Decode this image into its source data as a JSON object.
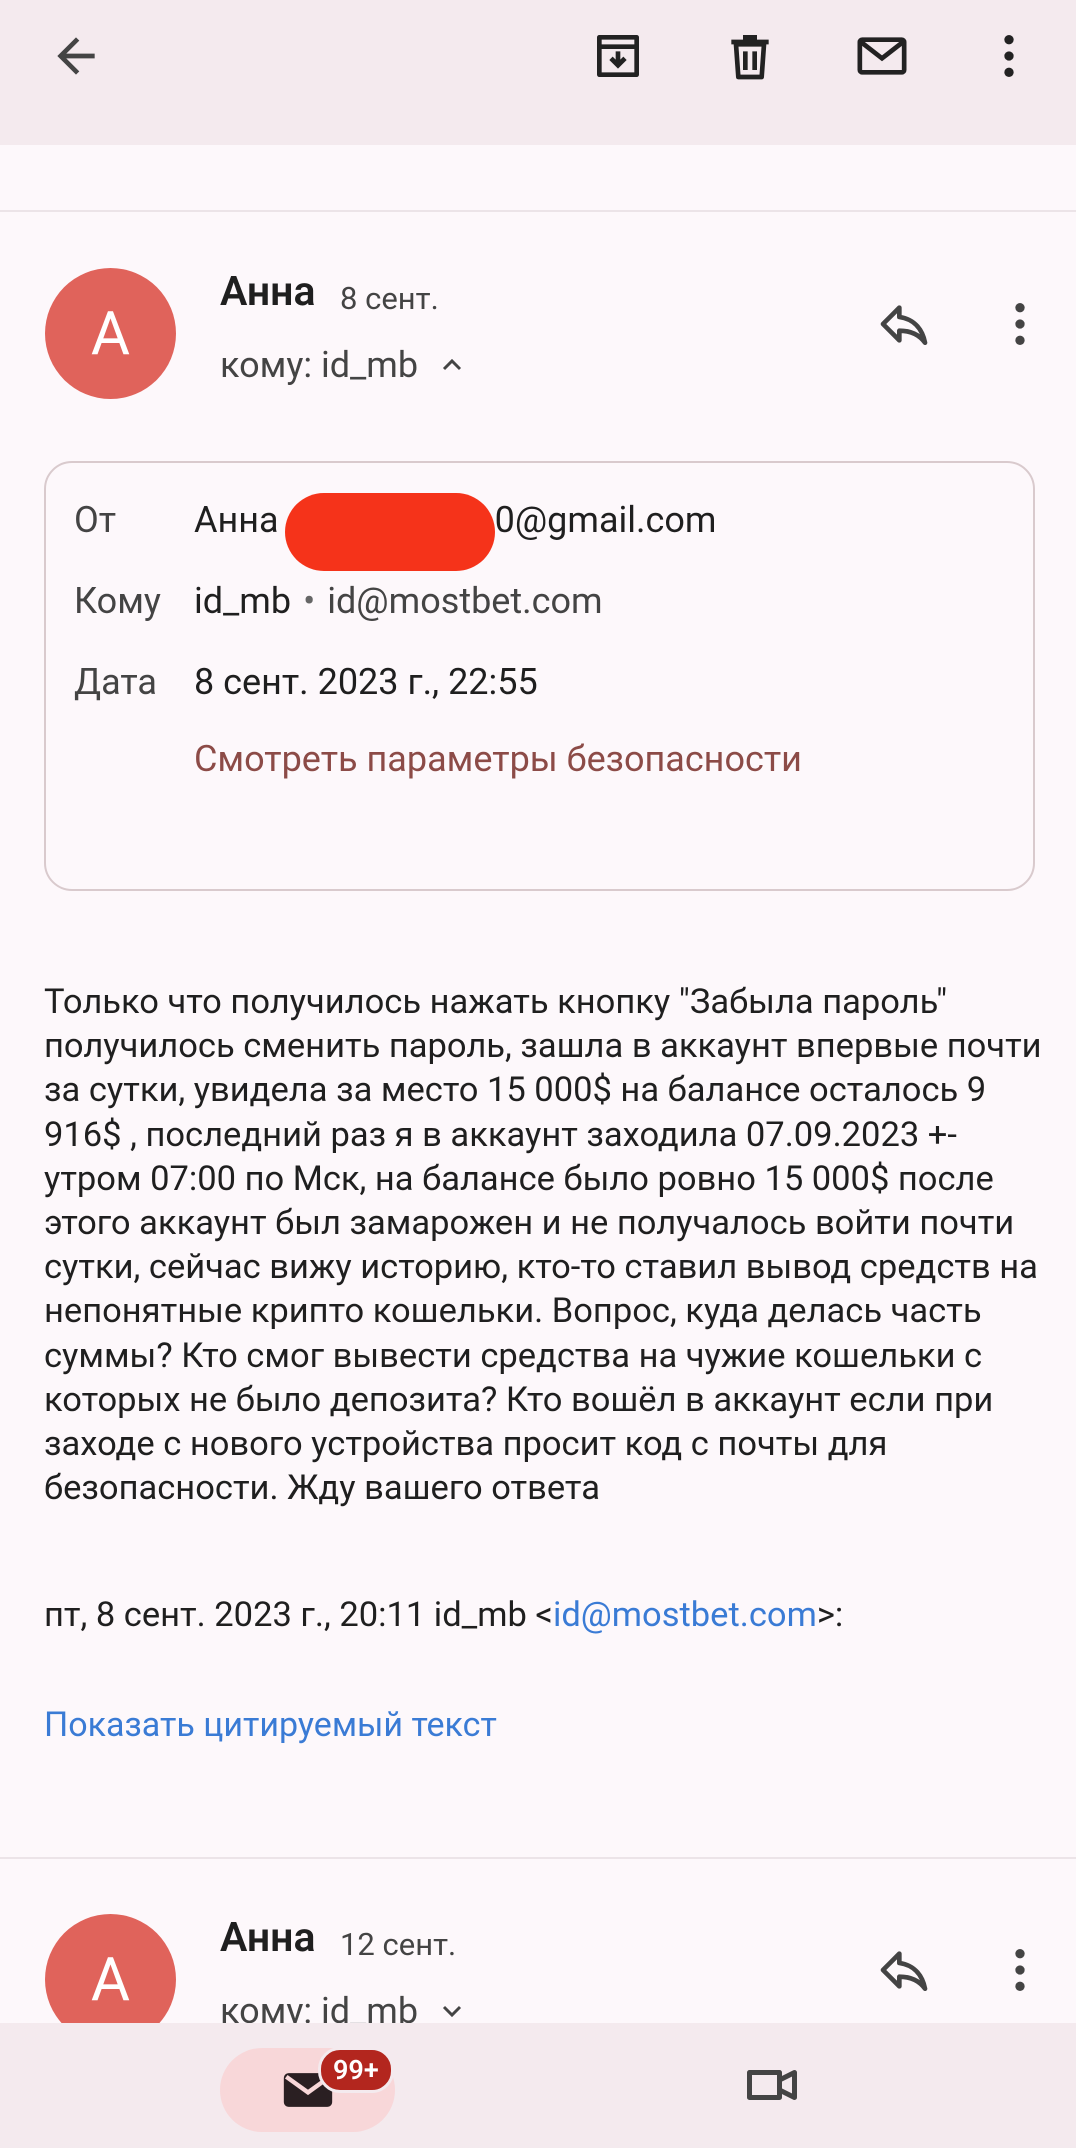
{
  "toolbar": {
    "back": "back-icon",
    "archive": "archive-icon",
    "delete": "delete-icon",
    "mark_unread": "mail-icon",
    "more": "more-icon"
  },
  "message1": {
    "avatar_letter": "А",
    "sender": "Анна",
    "date": "8 сент.",
    "to": "кому: id_mb",
    "details": {
      "from_label": "От",
      "from_name": "Анна",
      "from_email_tail": "0@gmail.com",
      "to_label": "Кому",
      "to_name": "id_mb",
      "to_email": "id@mostbet.com",
      "date_label": "Дата",
      "date_value": "8 сент. 2023 г., 22:55",
      "security_link": "Смотреть параметры безопасности"
    },
    "body": "Только что получилось нажать кнопку \"Забыла пароль\" получилось сменить пароль, зашла в аккаунт впервые почти за сутки, увидела за место 15 000$ на балансе осталось 9 916$ , последний раз я в аккаунт заходила 07.09.2023 +-  утром 07:00 по Мск, на балансе было ровно 15 000$ после этого аккаунт был замарожен и не получалось войти почти сутки, сейчас вижу историю, кто-то ставил вывод средств на непонятные крипто кошельки. Вопрос, куда делась часть суммы? Кто смог вывести средства на чужие кошельки с которых не было депозита? Кто вошёл в аккаунт если при заходе с нового устройства просит код с почты для безопасности. Жду вашего ответа",
    "quote_prefix": "пт, 8 сент. 2023 г., 20:11 id_mb <",
    "quote_email": "id@mostbet.com",
    "quote_suffix": ">:",
    "show_quoted": "Показать цитируемый текст"
  },
  "message2": {
    "avatar_letter": "А",
    "sender": "Анна",
    "date": "12 сент.",
    "to": "кому: id_mb"
  },
  "bottom_nav": {
    "mail_badge": "99+"
  }
}
